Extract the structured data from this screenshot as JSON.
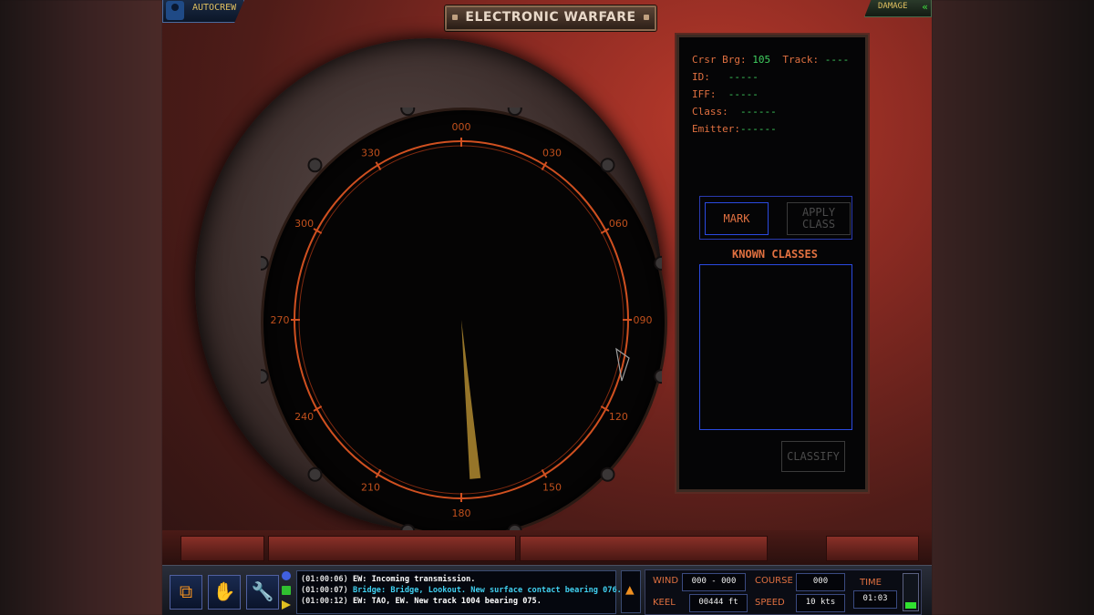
{
  "topbar": {
    "autocrew_label": "AUTOCREW",
    "damage_label": "DAMAGE",
    "screen_title": "ELECTRONIC WARFARE"
  },
  "scope": {
    "bearing_labels": [
      "000",
      "030",
      "060",
      "090",
      "120",
      "150",
      "180",
      "210",
      "240",
      "270",
      "300",
      "330"
    ],
    "needle_bearing_deg": 175,
    "cursor_icon": "triangle-cursor-icon"
  },
  "info": {
    "cursor_bearing_label": "Crsr Brg:",
    "cursor_bearing_value": "105",
    "track_label": "Track:",
    "track_value": "----",
    "id_label": "ID:",
    "id_value": "-----",
    "iff_label": "IFF:",
    "iff_value": "-----",
    "class_label": "Class:",
    "class_value": "------",
    "emitter_label": "Emitter:",
    "emitter_value": "------"
  },
  "buttons": {
    "mark": "MARK",
    "apply_class": "APPLY CLASS",
    "classify": "CLASSIFY"
  },
  "known_classes": {
    "title": "KNOWN CLASSES",
    "items": []
  },
  "toolbar": {
    "icons": [
      "windows-icon",
      "hand-icon",
      "wrench-icon"
    ]
  },
  "messages": [
    {
      "time": "(01:00:06)",
      "text": "EW: Incoming transmission.",
      "color": "#ffffff"
    },
    {
      "time": "(01:00:07)",
      "text": "Bridge: Bridge, Lookout. New surface contact bearing 076.",
      "color": "#40d0f0"
    },
    {
      "time": "(01:00:12)",
      "text": "EW: TAO, EW. New track 1004 bearing 075.",
      "color": "#ffffff"
    }
  ],
  "nav": {
    "wind_label": "WIND",
    "wind_value": "000 - 000",
    "keel_label": "KEEL",
    "keel_value": "00444 ft",
    "course_label": "COURSE",
    "course_value": "000",
    "speed_label": "SPEED",
    "speed_value": "10 kts",
    "time_label": "TIME",
    "time_value": "01:03",
    "fuel_level": 0.2
  },
  "colors": {
    "accent_orange": "#e07040",
    "value_green": "#40d060",
    "frame_blue": "#2a4ae0"
  }
}
